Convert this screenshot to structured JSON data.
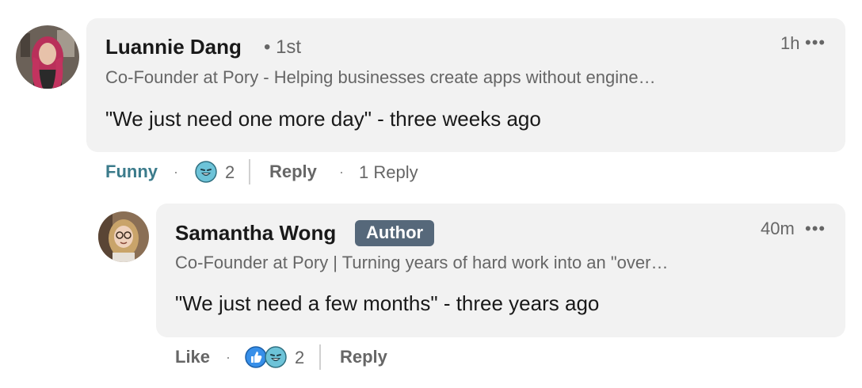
{
  "comment": {
    "author": "Luannie Dang",
    "degree": "• 1st",
    "headline": "Co-Founder at Pory - Helping businesses create apps without engine…",
    "text": "\"We just need one more day\" - three weeks ago",
    "time": "1h",
    "more_glyph": "•••",
    "actions": {
      "reaction_label": "Funny",
      "reaction_count": "2",
      "reply_label": "Reply",
      "reply_count": "1 Reply"
    },
    "icons": [
      "avatar-photo",
      "funny-reaction-icon",
      "more-options-icon"
    ]
  },
  "reply": {
    "author": "Samantha Wong",
    "badge": "Author",
    "headline": "Co-Founder at Pory | Turning years of hard work into an \"over…",
    "text": "\"We just need a few months\" - three years ago",
    "time": "40m",
    "more_glyph": "•••",
    "actions": {
      "like_label": "Like",
      "reaction_count": "2",
      "reply_label": "Reply"
    },
    "icons": [
      "avatar-photo",
      "like-reaction-icon",
      "funny-reaction-icon",
      "more-options-icon"
    ]
  },
  "colors": {
    "bubble": "#f2f2f2",
    "badge": "#56687a",
    "funny_label": "#3b7b8b",
    "like_blue": "#378fe9",
    "funny_teal": "#6dc3d8"
  }
}
